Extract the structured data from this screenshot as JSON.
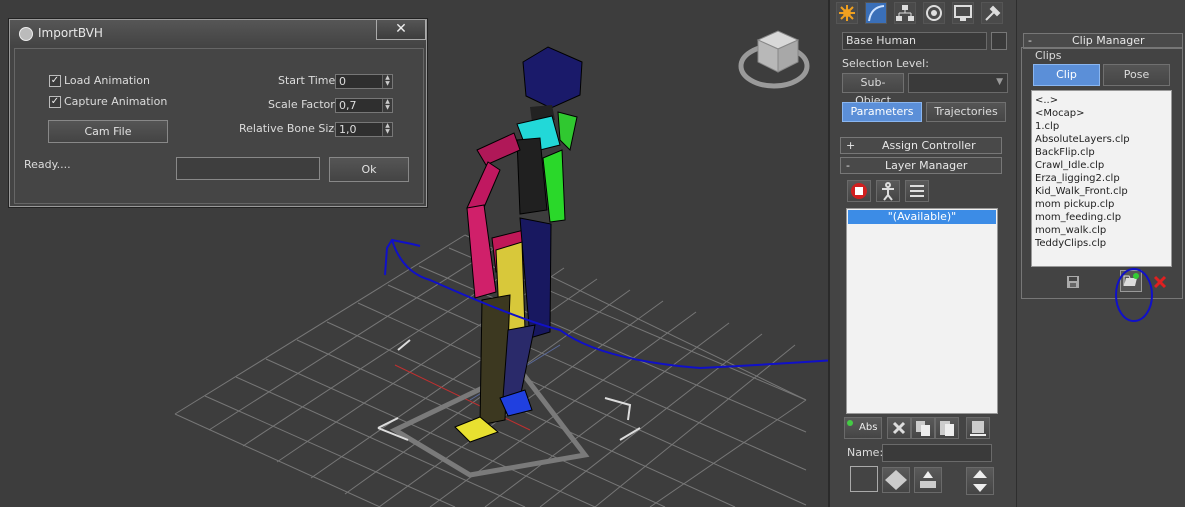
{
  "dialog": {
    "title": "ImportBVH",
    "close": "✕",
    "load_animation": "Load Animation",
    "capture_animation": "Capture Animation",
    "load_checked": "✓",
    "capture_checked": "✓",
    "cam_file": "Cam File",
    "start_time_label": "Start Time:",
    "start_time_value": "0",
    "scale_factor_label": "Scale Factor:",
    "scale_factor_value": "0,7",
    "bone_size_label": "Relative Bone Size:",
    "bone_size_value": "1,0",
    "status": "Ready....",
    "ok": "Ok"
  },
  "command_panel": {
    "tabs": [
      "create-icon",
      "modify-icon",
      "hierarchy-icon",
      "motion-icon",
      "display-icon",
      "utilities-icon"
    ],
    "object_name": "Base Human",
    "selection_level_label": "Selection Level:",
    "sub_object_label": "Sub-Object",
    "sub_object_value": "",
    "parameters_tab": "Parameters",
    "trajectories_tab": "Trajectories",
    "assign_controller_sign": "+",
    "assign_controller": "Assign Controller",
    "layer_manager_sign": "-",
    "layer_manager": "Layer Manager",
    "available_layer": "\"(Available)\"",
    "abs_label": "Abs",
    "name_label": "Name:"
  },
  "clip_manager": {
    "sign": "-",
    "title": "Clip Manager",
    "group_label": "Clips",
    "clip_tab": "Clip",
    "pose_tab": "Pose",
    "items": [
      "<..>",
      "<Mocap>",
      "1.clp",
      "AbsoluteLayers.clp",
      "BackFlip.clp",
      "Crawl_Idle.clp",
      "Erza_ligging2.clp",
      "Kid_Walk_Front.clp",
      "mom pickup.clp",
      "mom_feeding.clp",
      "mom_walk.clp",
      "TeddyClips.clp"
    ]
  },
  "colors": {
    "viewport_bg": "#3d3d3d",
    "accent_blue": "#5b8fd8",
    "annotation_ink": "#1010c8"
  }
}
